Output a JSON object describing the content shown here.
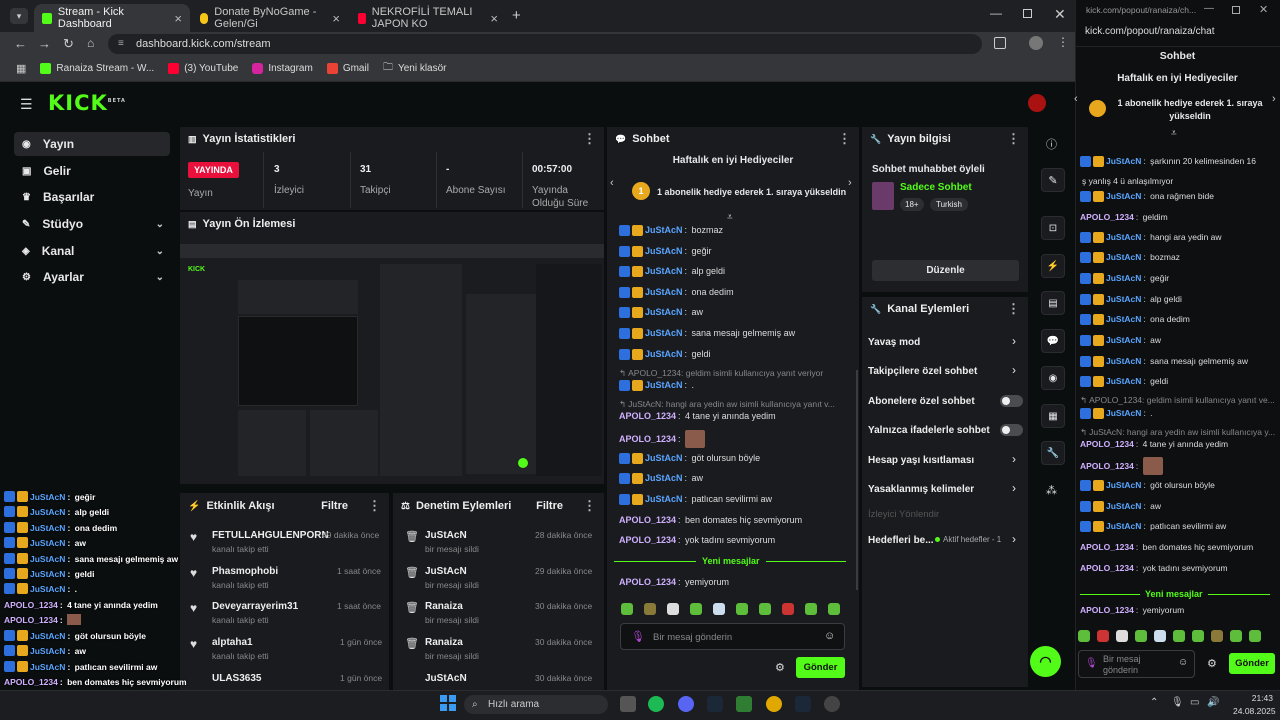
{
  "browser": {
    "tabs": [
      {
        "title": "Stream - Kick Dashboard",
        "color": "#53fc18"
      },
      {
        "title": "Donate ByNoGame - Gelen/Gi",
        "color": "#f5c518"
      },
      {
        "title": "NEKROFİLİ TEMALI JAPON KO",
        "color": "#ff0033"
      }
    ],
    "url": "dashboard.kick.com/stream",
    "bookmarks": [
      "Ranaiza Stream - W...",
      "(3) YouTube",
      "Instagram",
      "Gmail",
      "Yeni klasör"
    ]
  },
  "kick": {
    "logo": "KICK",
    "logo_tag": "BETA",
    "sidebar": [
      {
        "label": "Yayın"
      },
      {
        "label": "Gelir"
      },
      {
        "label": "Başarılar"
      },
      {
        "label": "Stüdyo"
      },
      {
        "label": "Kanal"
      },
      {
        "label": "Ayarlar"
      }
    ],
    "stats": {
      "title": "Yayın İstatistikleri",
      "live": "YAYINDA",
      "live_sub": "Yayın",
      "viewers": "3",
      "viewers_label": "İzleyici",
      "followers": "31",
      "followers_label": "Takipçi",
      "subs": "-",
      "subs_label": "Abone Sayısı",
      "uptime": "00:57:00",
      "uptime_label_1": "Yayında",
      "uptime_label_2": "Olduğu Süre"
    },
    "preview": {
      "title": "Yayın Ön İzlemesi"
    },
    "activity": {
      "title": "Etkinlik Akışı",
      "filter": "Filtre",
      "items": [
        {
          "name": "FETULLAHGULENPORN",
          "sub": "kanalı takip etti",
          "time": "49 dakika önce"
        },
        {
          "name": "Phasmophobi",
          "sub": "kanalı takip etti",
          "time": "1 saat önce"
        },
        {
          "name": "Deveyarrayerim31",
          "sub": "kanalı takip etti",
          "time": "1 saat önce"
        },
        {
          "name": "alptaha1",
          "sub": "kanalı takip etti",
          "time": "1 gün önce"
        },
        {
          "name": "ULAS3635",
          "sub": "",
          "time": "1 gün önce"
        }
      ]
    },
    "moderation": {
      "title": "Denetim Eylemleri",
      "filter": "Filtre",
      "items": [
        {
          "name": "JuStAcN",
          "sub": "bir mesajı sildi",
          "time": "28 dakika önce"
        },
        {
          "name": "JuStAcN",
          "sub": "bir mesajı sildi",
          "time": "29 dakika önce"
        },
        {
          "name": "Ranaiza",
          "sub": "bir mesajı sildi",
          "time": "30 dakika önce"
        },
        {
          "name": "Ranaiza",
          "sub": "bir mesajı sildi",
          "time": "30 dakika önce"
        },
        {
          "name": "JuStAcN",
          "sub": "",
          "time": "30 dakika önce"
        }
      ]
    },
    "chat": {
      "title": "Sohbet",
      "top_gifters": "Haftalık en iyi Hediyeciler",
      "gift_rank": "1",
      "gift_text": "1 abonelik hediye ederek 1. sıraya yükseldin",
      "new_messages": "Yeni mesajlar",
      "placeholder": "Bir mesaj gönderin",
      "send": "Gönder",
      "messages": [
        {
          "user": "JuStAcN",
          "text": "bozmaz"
        },
        {
          "user": "JuStAcN",
          "text": "geğir"
        },
        {
          "user": "JuStAcN",
          "text": "alp geldi"
        },
        {
          "user": "JuStAcN",
          "text": "ona dedim"
        },
        {
          "user": "JuStAcN",
          "text": "aw"
        },
        {
          "user": "JuStAcN",
          "text": "sana mesajı gelmemiş aw"
        },
        {
          "user": "JuStAcN",
          "text": "geldi"
        }
      ],
      "reply1": "APOLO_1234: geldim isimli kullanıcıya yanıt veriyor",
      "reply1_msg": {
        "user": "JuStAcN",
        "text": "."
      },
      "reply2": "JuStAcN: hangi ara yedin aw isimli kullanıcıya yanıt v...",
      "reply2_msg": {
        "user": "APOLO_1234",
        "text": "4 tane yi anında yedim"
      },
      "apolo_emote": {
        "user": "APOLO_1234"
      },
      "messages2": [
        {
          "user": "JuStAcN",
          "text": "göt olursun böyle"
        },
        {
          "user": "JuStAcN",
          "text": "aw"
        },
        {
          "user": "JuStAcN",
          "text": "patlıcan sevilirmi aw"
        }
      ],
      "apolo1": {
        "user": "APOLO_1234",
        "text": "ben domates hiç sevmiyorum"
      },
      "apolo2": {
        "user": "APOLO_1234",
        "text": "yok tadını sevmiyorum"
      },
      "apolo3": {
        "user": "APOLO_1234",
        "text": "yemiyorum"
      }
    },
    "info": {
      "title": "Yayın bilgisi",
      "stream_title": "Sohbet muhabbet öyleli",
      "category": "Sadece Sohbet",
      "tags": [
        "18+",
        "Turkish"
      ],
      "edit": "Düzenle"
    },
    "actions": {
      "title": "Kanal Eylemleri",
      "items": [
        {
          "label": "Yavaş mod",
          "kind": "arrow"
        },
        {
          "label": "Takipçilere özel sohbet",
          "kind": "arrow"
        },
        {
          "label": "Abonelere özel sohbet",
          "kind": "toggle"
        },
        {
          "label": "Yalnızca ifadelerle sohbet",
          "kind": "toggle"
        },
        {
          "label": "Hesap yaşı kısıtlaması",
          "kind": "arrow"
        },
        {
          "label": "Yasaklanmış kelimeler",
          "kind": "arrow"
        }
      ],
      "viewer_redirect": "İzleyici Yönlendir",
      "goals": "Hedefleri be...",
      "goals_active": "Aktif hedefler - 1"
    }
  },
  "popout": {
    "url": "kick.com/popout/ranaiza/ch...",
    "url2": "kick.com/popout/ranaiza/chat",
    "title": "Sohbet",
    "top_gifters": "Haftalık en iyi Hediyeciler",
    "gift_text": "1 abonelik hediye ederek 1. sıraya yükseldin",
    "msgs": [
      {
        "user": "JuStAcN",
        "text": "şarkının 20 kelimesinden 16"
      },
      {
        "user": "",
        "text": "ş yanlış 4 ü anlaşılmıyor"
      },
      {
        "user": "JuStAcN",
        "text": "ona rağmen bide"
      },
      {
        "user": "APOLO_1234",
        "text": "geldim"
      },
      {
        "user": "JuStAcN",
        "text": "hangi ara yedin aw"
      },
      {
        "user": "JuStAcN",
        "text": "bozmaz"
      },
      {
        "user": "JuStAcN",
        "text": "geğir"
      },
      {
        "user": "JuStAcN",
        "text": "alp geldi"
      },
      {
        "user": "JuStAcN",
        "text": "ona dedim"
      },
      {
        "user": "JuStAcN",
        "text": "aw"
      },
      {
        "user": "JuStAcN",
        "text": "sana mesajı gelmemiş aw"
      },
      {
        "user": "JuStAcN",
        "text": "geldi"
      }
    ],
    "reply1": "APOLO_1234: geldim isimli kullanıcıya yanıt ve...",
    "reply1_msg": {
      "user": "JuStAcN",
      "text": "."
    },
    "reply2": "JuStAcN: hangi ara yedin aw isimli kullanıcıya y...",
    "apolo_a": {
      "user": "APOLO_1234",
      "text": "4 tane yi anında yedim"
    },
    "apolo_emote": {
      "user": "APOLO_1234"
    },
    "msgs2": [
      {
        "user": "JuStAcN",
        "text": "göt olursun böyle"
      },
      {
        "user": "JuStAcN",
        "text": "aw"
      },
      {
        "user": "JuStAcN",
        "text": "patlıcan sevilirmi aw"
      }
    ],
    "apolo_b": {
      "user": "APOLO_1234",
      "text": "ben domates hiç sevmiyorum"
    },
    "apolo_c": {
      "user": "APOLO_1234",
      "text": "yok tadını sevmiyorum"
    },
    "new_messages": "Yeni mesajlar",
    "apolo_d": {
      "user": "APOLO_1234",
      "text": "yemiyorum"
    },
    "placeholder": "Bir mesaj gönderin",
    "send": "Gönder"
  },
  "overlay": [
    {
      "user": "JuStAcN",
      "text": "geğir"
    },
    {
      "user": "JuStAcN",
      "text": "alp geldi"
    },
    {
      "user": "JuStAcN",
      "text": "ona dedim"
    },
    {
      "user": "JuStAcN",
      "text": "aw"
    },
    {
      "user": "JuStAcN",
      "text": "sana mesajı gelmemiş aw"
    },
    {
      "user": "JuStAcN",
      "text": "geldi"
    },
    {
      "user": "JuStAcN",
      "text": "."
    },
    {
      "user": "APOLO_1234",
      "text": "4 tane yi anında yedim"
    },
    {
      "user": "APOLO_1234",
      "text": ""
    },
    {
      "user": "JuStAcN",
      "text": "göt olursun böyle"
    },
    {
      "user": "JuStAcN",
      "text": "aw"
    },
    {
      "user": "JuStAcN",
      "text": "patlıcan sevilirmi aw"
    },
    {
      "user": "APOLO_1234",
      "text": "ben domates hiç sevmiyorum"
    },
    {
      "user": "APOLO_1234",
      "text": "yok tadını sevmiyorum"
    },
    {
      "user": "APOLO_1234",
      "text": "yemiyorum"
    }
  ],
  "taskbar": {
    "search": "Hızlı arama",
    "time": "21:43",
    "date": "24.08.2025"
  },
  "colors": {
    "accent": "#53fc18",
    "live": "#e9113c",
    "panel": "#191b1f",
    "bg": "#0b0e0f"
  }
}
